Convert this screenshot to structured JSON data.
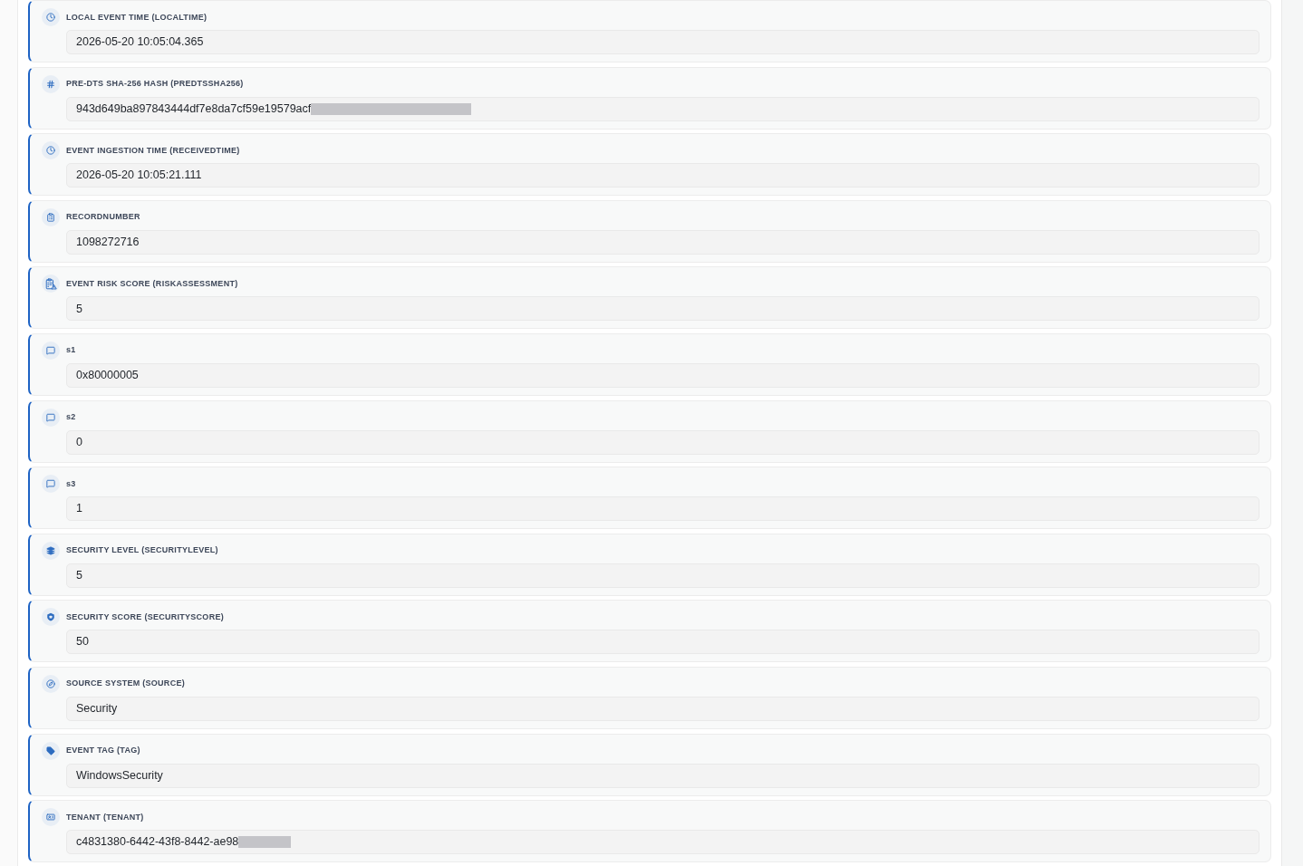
{
  "fields": [
    {
      "kind": "time",
      "label": "LOCAL EVENT TIME (LOCALTIME)",
      "value": "2026-05-20 10:05:04.365",
      "redacted": false
    },
    {
      "kind": "hash",
      "label": "PRE-DTS SHA-256 HASH (PREDTSSHA256)",
      "value": "943d649ba897843444df7e8da7cf59e19579acf",
      "redacted": true
    },
    {
      "kind": "time",
      "label": "EVENT INGESTION TIME (RECEIVEDTIME)",
      "value": "2026-05-20 10:05:21.111",
      "redacted": false
    },
    {
      "kind": "record",
      "label": "RECORDNUMBER",
      "value": "1098272716",
      "redacted": false
    },
    {
      "kind": "risk",
      "label": "EVENT RISK SCORE (RISKASSESSMENT)",
      "value": "5",
      "redacted": false
    },
    {
      "kind": "string",
      "label": "s1",
      "value": "0x80000005",
      "redacted": false
    },
    {
      "kind": "string",
      "label": "s2",
      "value": "0",
      "redacted": false
    },
    {
      "kind": "string",
      "label": "s3",
      "value": "1",
      "redacted": false
    },
    {
      "kind": "level",
      "label": "SECURITY LEVEL (SECURITYLEVEL)",
      "value": "5",
      "redacted": false
    },
    {
      "kind": "score",
      "label": "SECURITY SCORE (SECURITYSCORE)",
      "value": "50",
      "redacted": false
    },
    {
      "kind": "source",
      "label": "SOURCE SYSTEM (SOURCE)",
      "value": "Security",
      "redacted": false
    },
    {
      "kind": "tag",
      "label": "EVENT TAG (TAG)",
      "value": "WindowsSecurity",
      "redacted": false
    },
    {
      "kind": "tenant",
      "label": "TENANT (TENANT)",
      "value": "c4831380-6442-43f8-8442-ae98",
      "redacted": true
    }
  ]
}
